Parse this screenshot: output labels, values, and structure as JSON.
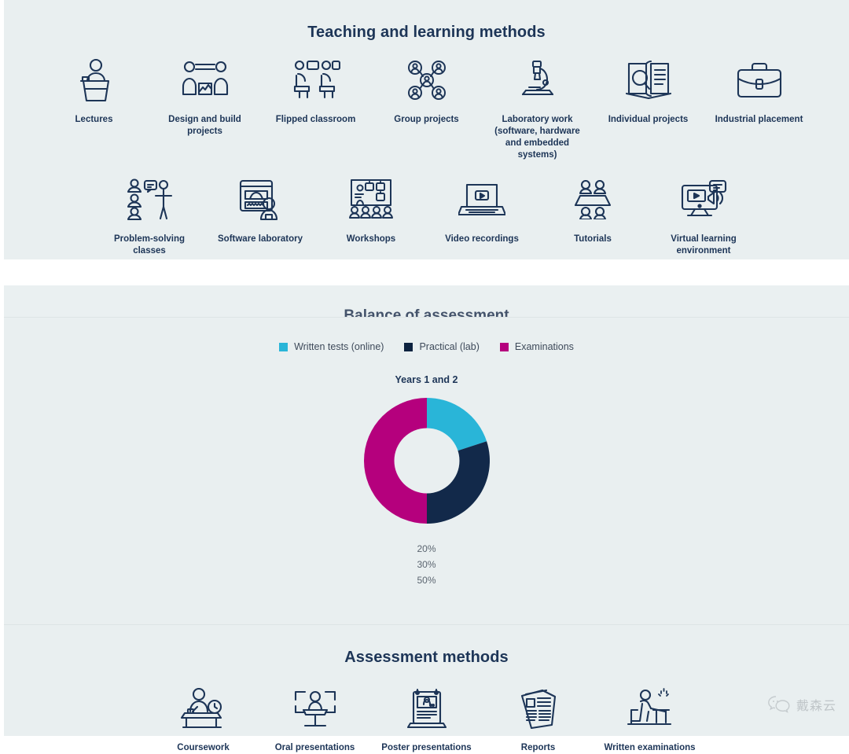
{
  "teaching": {
    "title": "Teaching and learning methods",
    "row1": [
      {
        "icon": "lectern-speaker-icon",
        "label": "Lectures"
      },
      {
        "icon": "design-build-projects-icon",
        "label": "Design and build projects"
      },
      {
        "icon": "flipped-classroom-icon",
        "label": "Flipped classroom"
      },
      {
        "icon": "group-projects-icon",
        "label": "Group projects"
      },
      {
        "icon": "microscope-icon",
        "label": "Laboratory work (software, hardware and embedded systems)"
      },
      {
        "icon": "book-magnifier-icon",
        "label": "Individual projects"
      },
      {
        "icon": "briefcase-icon",
        "label": "Industrial placement"
      }
    ],
    "row2": [
      {
        "icon": "problem-solving-icon",
        "label": "Problem-solving classes"
      },
      {
        "icon": "software-laboratory-icon",
        "label": "Software laboratory"
      },
      {
        "icon": "workshops-icon",
        "label": "Workshops"
      },
      {
        "icon": "laptop-video-icon",
        "label": "Video recordings"
      },
      {
        "icon": "tutorials-icon",
        "label": "Tutorials"
      },
      {
        "icon": "virtual-learning-icon",
        "label": "Virtual learning environment"
      }
    ]
  },
  "balance": {
    "title": "Balance of assessment",
    "subtitle": "Years 1 and 2",
    "percent_labels": [
      "20%",
      "30%",
      "50%"
    ]
  },
  "assessment": {
    "title": "Assessment methods",
    "items": [
      {
        "icon": "coursework-desk-icon",
        "label": "Coursework"
      },
      {
        "icon": "oral-presentation-icon",
        "label": "Oral presentations"
      },
      {
        "icon": "poster-presentation-icon",
        "label": "Poster presentations"
      },
      {
        "icon": "reports-papers-icon",
        "label": "Reports"
      },
      {
        "icon": "written-exam-icon",
        "label": "Written examinations"
      }
    ]
  },
  "watermark": {
    "icon": "wechat-bubbles-icon",
    "text": "戴森云"
  },
  "colors": {
    "background": "#e9eff0",
    "ink": "#1d3557",
    "cyan": "#29b5d8",
    "navy": "#0d2340",
    "magenta": "#b5007d"
  },
  "chart_data": {
    "type": "pie",
    "title": "Balance of assessment",
    "subtitle": "Years 1 and 2",
    "categories": [
      "Written tests (online)",
      "Practical (lab)",
      "Examinations"
    ],
    "values": [
      20,
      30,
      50
    ],
    "value_labels": [
      "20%",
      "30%",
      "50%"
    ],
    "colors": [
      "#29b5d8",
      "#0d2340",
      "#b5007d"
    ],
    "legend": [
      "Written tests (online)",
      "Practical (lab)",
      "Examinations"
    ],
    "legend_position": "top",
    "donut": true,
    "inner_radius_ratio": 0.52,
    "start_angle_deg": 0,
    "direction": "clockwise",
    "unit": "%",
    "grid": false
  }
}
